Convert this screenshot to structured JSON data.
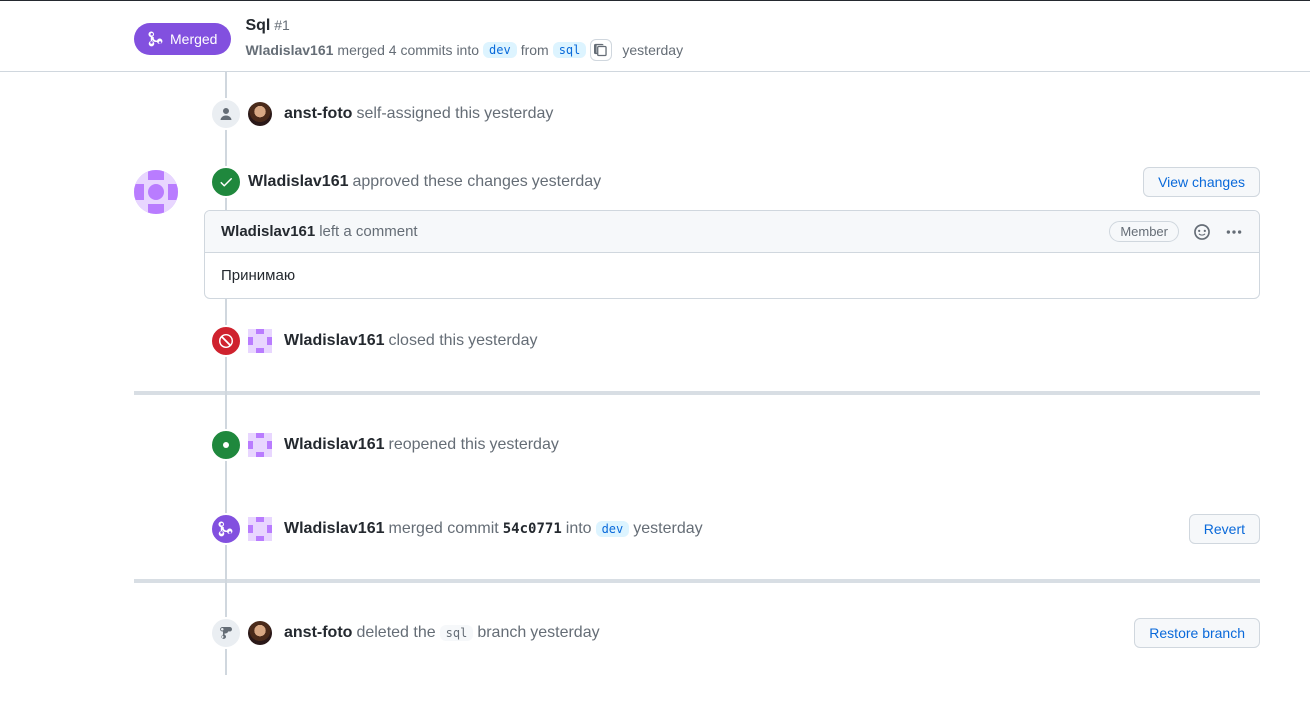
{
  "header": {
    "state_label": "Merged",
    "title": "Sql",
    "number": "#1",
    "actor": "Wladislav161",
    "merged_text_1": "merged 4 commits into",
    "base_branch": "dev",
    "from_text": "from",
    "head_branch": "sql",
    "timestamp": "yesterday"
  },
  "events": {
    "assign": {
      "actor": "anst-foto",
      "text": "self-assigned this",
      "time": "yesterday"
    },
    "approve": {
      "actor": "Wladislav161",
      "text": "approved these changes",
      "time": "yesterday",
      "button": "View changes"
    },
    "comment": {
      "actor": "Wladislav161",
      "subtext": "left a comment",
      "role": "Member",
      "body": "Принимаю"
    },
    "closed": {
      "actor": "Wladislav161",
      "text": "closed this",
      "time": "yesterday"
    },
    "reopened": {
      "actor": "Wladislav161",
      "text": "reopened this",
      "time": "yesterday"
    },
    "merged": {
      "actor": "Wladislav161",
      "text1": "merged commit",
      "sha": "54c0771",
      "text2": "into",
      "branch": "dev",
      "time": "yesterday",
      "button": "Revert"
    },
    "deleted": {
      "actor": "anst-foto",
      "text1": "deleted the",
      "branch": "sql",
      "text2": "branch",
      "time": "yesterday",
      "button": "Restore branch"
    }
  }
}
